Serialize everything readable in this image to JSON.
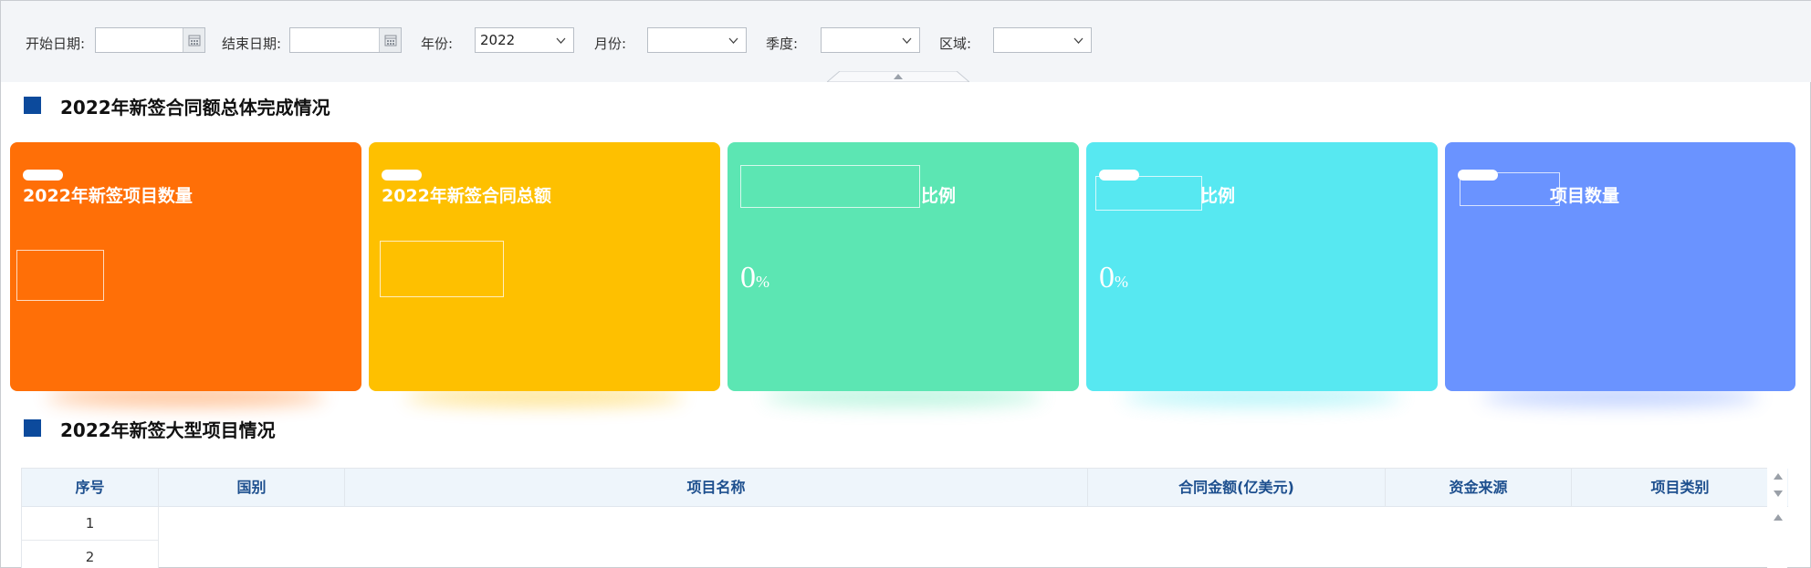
{
  "filters": {
    "start_date_label": "开始日期:",
    "start_date_value": "",
    "end_date_label": "结束日期:",
    "end_date_value": "",
    "year_label": "年份:",
    "year_value": "2022",
    "month_label": "月份:",
    "month_value": "",
    "quarter_label": "季度:",
    "quarter_value": "",
    "region_label": "区域:",
    "region_value": ""
  },
  "section1": {
    "title": "2022年新签合同额总体完成情况"
  },
  "cards": [
    {
      "title": "2022年新签项目数量",
      "value": "",
      "unit": "",
      "color": "#ff6f07"
    },
    {
      "title": "2022年新签合同总额",
      "value": "",
      "unit": "",
      "color": "#fec000"
    },
    {
      "title": "比例",
      "value": "0",
      "unit": "%",
      "color": "#5ce6b3"
    },
    {
      "title": "比例",
      "value": "0",
      "unit": "%",
      "color": "#57e8f1"
    },
    {
      "title": "项目数量",
      "value": "",
      "unit": "",
      "color": "#6a93ff"
    }
  ],
  "section2": {
    "title": "2022年新签大型项目情况"
  },
  "table": {
    "headers": [
      "序号",
      "国别",
      "项目名称",
      "合同金额(亿美元)",
      "资金来源",
      "项目类别"
    ],
    "rows": [
      {
        "index": "1"
      },
      {
        "index": "2"
      }
    ]
  },
  "colors": {
    "section_marker": "#0c4a9c",
    "header_text": "#1d4f8e",
    "header_bg": "#eef5fb"
  }
}
